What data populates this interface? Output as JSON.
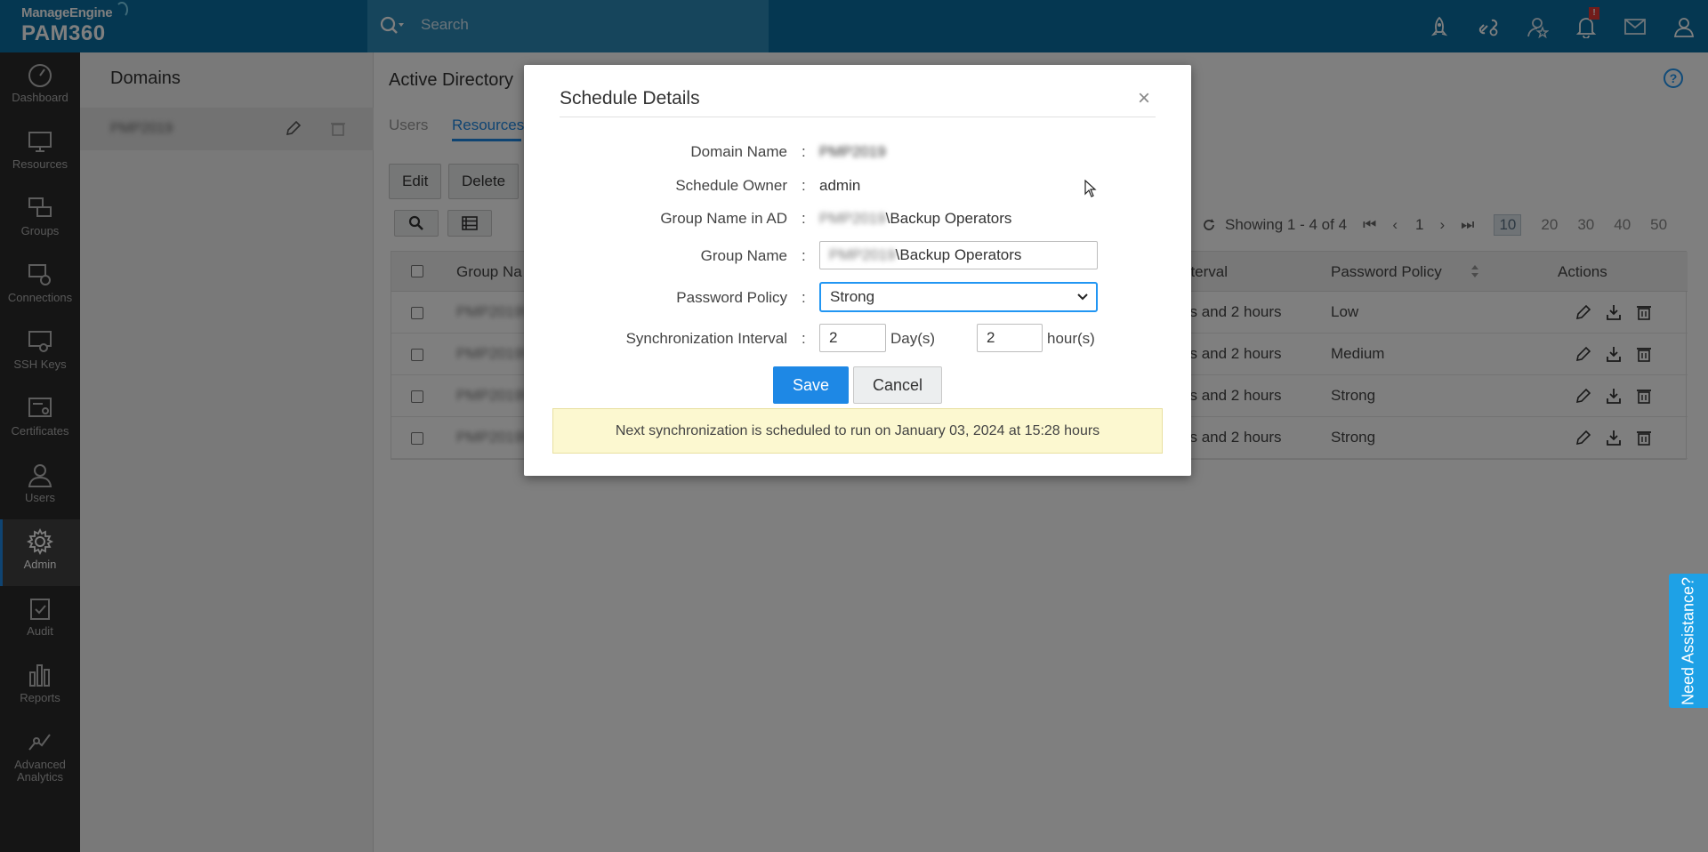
{
  "app": {
    "brand_small": "ManageEngine",
    "brand_large": "PAM360",
    "search_placeholder": "Search",
    "notification_badge": "!"
  },
  "sidebar": {
    "items": [
      {
        "label": "Dashboard",
        "icon": "dashboard-icon"
      },
      {
        "label": "Resources",
        "icon": "monitor-icon"
      },
      {
        "label": "Groups",
        "icon": "groups-icon"
      },
      {
        "label": "Connections",
        "icon": "connections-icon"
      },
      {
        "label": "SSH Keys",
        "icon": "ssh-keys-icon"
      },
      {
        "label": "Certificates",
        "icon": "certificates-icon"
      },
      {
        "label": "Users",
        "icon": "user-icon"
      },
      {
        "label": "Admin",
        "icon": "gear-icon",
        "active": true
      },
      {
        "label": "Audit",
        "icon": "audit-icon"
      },
      {
        "label": "Reports",
        "icon": "reports-icon"
      },
      {
        "label": "Advanced Analytics",
        "icon": "analytics-icon"
      }
    ]
  },
  "domains_panel": {
    "title": "Domains",
    "domain_name": "PMP2019"
  },
  "main": {
    "title": "Active Directory",
    "tabs": [
      "Users",
      "Resources"
    ],
    "buttons": {
      "edit": "Edit",
      "delete": "Delete"
    },
    "pager": {
      "showing": "Showing 1 - 4 of 4",
      "page": "1",
      "sizes": [
        "10",
        "20",
        "30",
        "40",
        "50"
      ],
      "selected_size": "10"
    },
    "columns": {
      "group_name": "Group Na",
      "interval": "nterval",
      "password_policy": "Password Policy",
      "actions": "Actions"
    },
    "rows": [
      {
        "group": "PMP2019\\",
        "interval": "ys and 2 hours",
        "policy": "Low"
      },
      {
        "group": "PMP2019\\",
        "interval": "ys and 2 hours",
        "policy": "Medium"
      },
      {
        "group": "PMP2019\\",
        "interval": "ys and 2 hours",
        "policy": "Strong"
      },
      {
        "group": "PMP2019\\",
        "interval": "ys and 2 hours",
        "policy": "Strong"
      }
    ]
  },
  "modal": {
    "title": "Schedule Details",
    "close": "×",
    "labels": {
      "domain_name": "Domain Name",
      "schedule_owner": "Schedule Owner",
      "group_name_ad": "Group Name in AD",
      "group_name": "Group Name",
      "password_policy": "Password Policy",
      "sync_interval": "Synchronization Interval"
    },
    "colon": ":",
    "values": {
      "domain_name": "PMP2019",
      "schedule_owner": "admin",
      "group_name_ad_prefix": "PMP2019",
      "group_name_ad_suffix": "\\Backup Operators",
      "group_name_prefix": "PMP2019",
      "group_name_suffix": "\\Backup Operators",
      "password_policy": "Strong",
      "days": "2",
      "days_unit": "Day(s)",
      "hours": "2",
      "hours_unit": "hour(s)"
    },
    "save": "Save",
    "cancel": "Cancel",
    "notice": "Next synchronization is scheduled to run on January 03, 2024 at 15:28 hours"
  },
  "need_assistance": "Need Assistance?"
}
